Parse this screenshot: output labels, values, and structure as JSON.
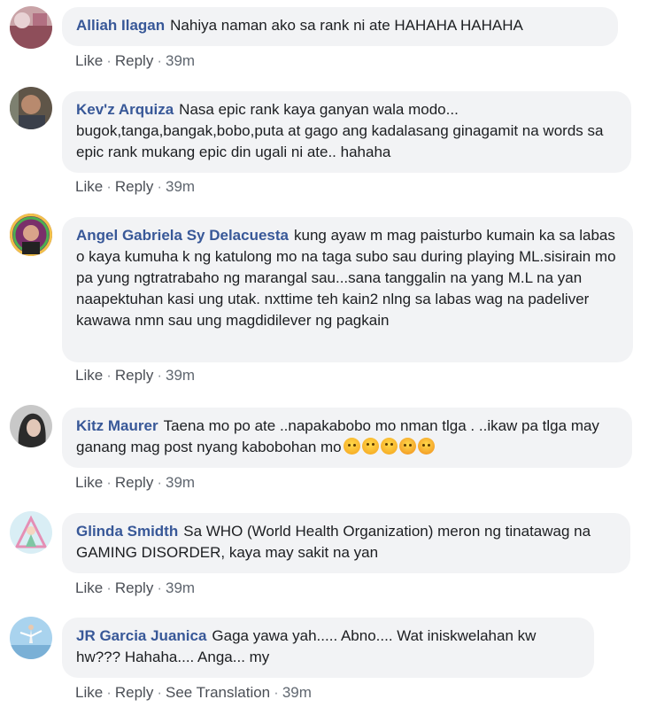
{
  "comments": [
    {
      "name": "Alliah Ilagan",
      "text": "Nahiya naman ako sa rank ni ate HAHAHA HAHAHA",
      "actions": {
        "like": "Like",
        "reply": "Reply",
        "time": "39m"
      }
    },
    {
      "name": "Kev'z Arquiza",
      "text": "Nasa epic rank kaya ganyan wala modo... bugok,tanga,bangak,bobo,puta at gago ang kadalasang ginagamit na words sa epic rank mukang epic din ugali ni ate.. hahaha",
      "actions": {
        "like": "Like",
        "reply": "Reply",
        "time": "39m"
      }
    },
    {
      "name": "Angel Gabriela Sy Delacuesta",
      "text": "kung ayaw m mag paisturbo kumain ka sa labas o kaya kumuha k ng katulong mo na taga subo sau during playing ML.sisirain mo pa yung ngtratrabaho ng marangal sau...sana tanggalin na yang M.L na yan naapektuhan kasi ung utak. nxttime teh kain2 nlng sa labas wag na padeliver kawawa nmn sau ung magdidilever ng pagkain",
      "actions": {
        "like": "Like",
        "reply": "Reply",
        "time": "39m"
      }
    },
    {
      "name": "Kitz Maurer",
      "text": "Taena mo po ate ..napakabobo mo nman tlga . ..ikaw pa tlga may ganang mag post nyang kabobohan mo",
      "emojis": [
        "angry-emoji",
        "sad-emoji",
        "sad-emoji",
        "steam-emoji",
        "steam-emoji"
      ],
      "actions": {
        "like": "Like",
        "reply": "Reply",
        "time": "39m"
      }
    },
    {
      "name": "Glinda Smidth",
      "text": "Sa WHO (World Health Organization) meron ng tinatawag na GAMING DISORDER, kaya may sakit na yan",
      "actions": {
        "like": "Like",
        "reply": "Reply",
        "time": "39m"
      }
    },
    {
      "name": "JR Garcia Juanica",
      "text": "Gaga yawa yah..... Abno.... Wat iniskwelahan kw hw??? Hahaha.... Anga... my",
      "actions": {
        "like": "Like",
        "reply": "Reply",
        "translate": "See Translation",
        "time": "39m"
      }
    }
  ]
}
